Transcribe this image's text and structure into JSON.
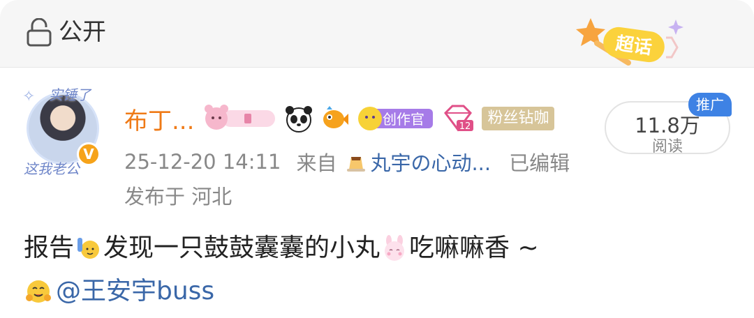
{
  "header": {
    "visibility_label": "公开",
    "supertopic_label": "超话"
  },
  "user": {
    "name": "布丁...",
    "avatar_top_text": "实锤了",
    "avatar_bottom_text": "这我老公",
    "fans_badge": "粉丝钻咖",
    "creator_badge": "创作官",
    "level_number": "12"
  },
  "meta": {
    "timestamp": "25-12-20 14:11",
    "from_label": "来自",
    "app_name": "丸宇の心动...",
    "edited_label": "已编辑",
    "location": "发布于 河北"
  },
  "stats": {
    "read_count": "11.8万",
    "read_label": "阅读",
    "promo_tag": "推广"
  },
  "post": {
    "text_part1": "报告",
    "text_part2": "发现一只鼓鼓囊囊的小丸",
    "text_part3": "吃嘛嘛香 ~",
    "mention": "@王安宇buss"
  },
  "colors": {
    "username": "#ef7a16",
    "link": "#3a67a8",
    "promo": "#3e82e4",
    "verify": "#f6a31a"
  }
}
